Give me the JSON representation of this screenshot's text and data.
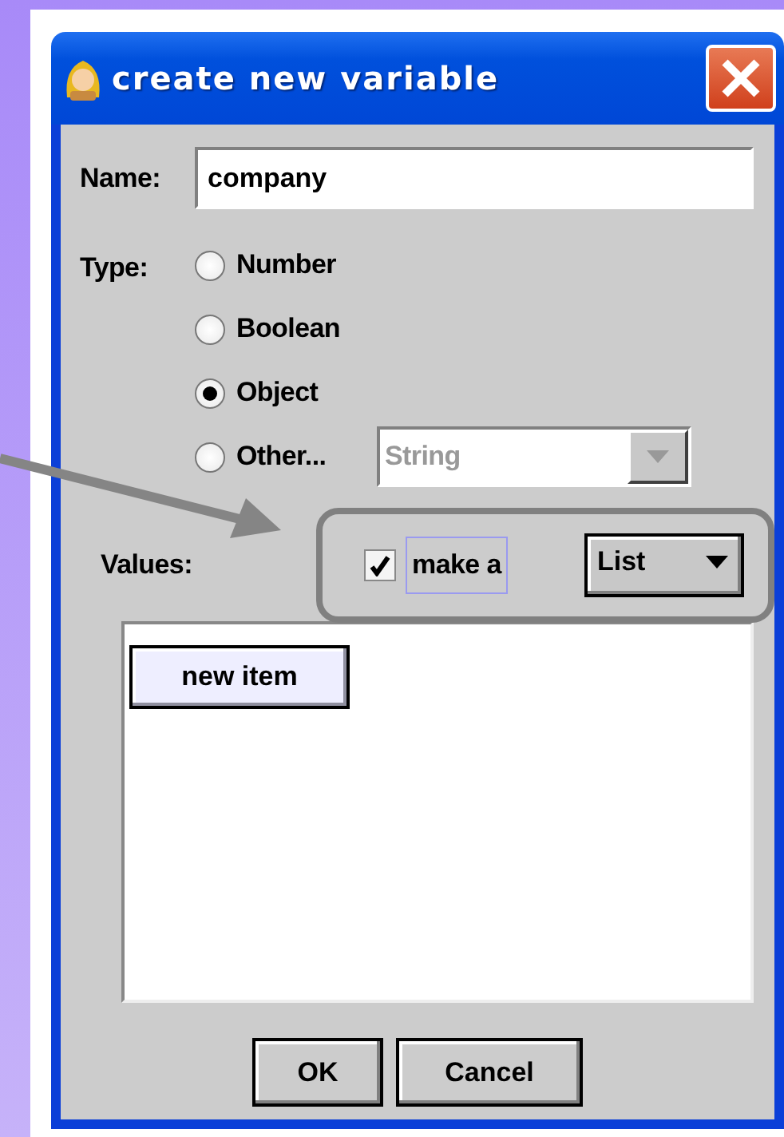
{
  "window": {
    "title": "create new variable"
  },
  "name_field": {
    "label": "Name:",
    "value": "company"
  },
  "type": {
    "label": "Type:",
    "options": [
      {
        "label": "Number",
        "selected": false
      },
      {
        "label": "Boolean",
        "selected": false
      },
      {
        "label": "Object",
        "selected": true
      },
      {
        "label": "Other...",
        "selected": false
      }
    ]
  },
  "other_combo": {
    "value": "String",
    "disabled": true
  },
  "values": {
    "label": "Values:",
    "make_checkbox": {
      "label": "make a",
      "checked": true
    },
    "collection_combo": {
      "value": "List"
    }
  },
  "items_list": {
    "button": "new item"
  },
  "buttons": [
    "OK",
    "Cancel"
  ]
}
